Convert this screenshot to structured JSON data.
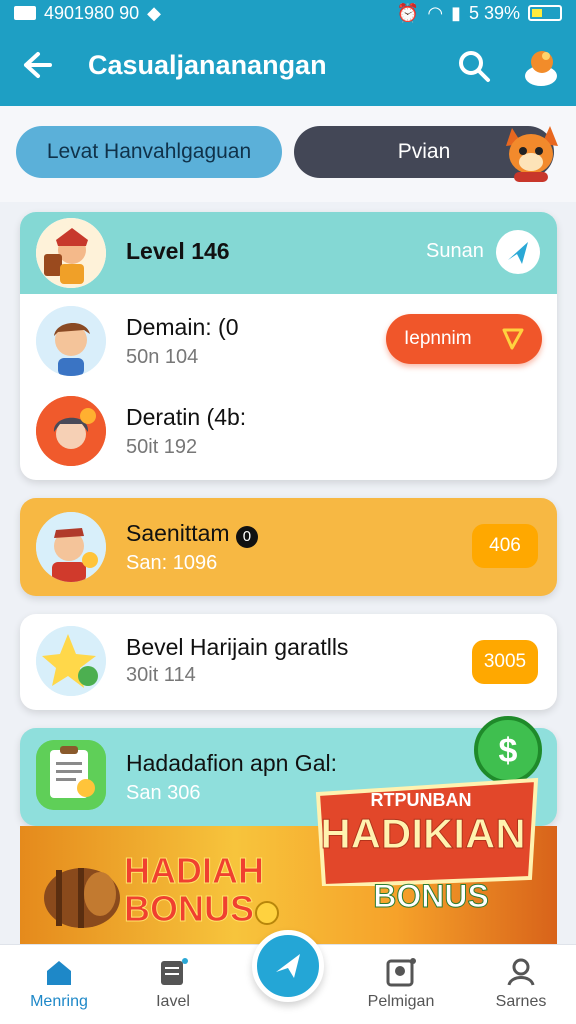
{
  "status_bar": {
    "left_text": "4901980 90",
    "battery_text": "5 39%"
  },
  "app_bar": {
    "title": "Casualjananangan"
  },
  "tabs": {
    "level_label": "Levat Hanvahlgaguan",
    "other_label": "Pvian"
  },
  "cards": [
    {
      "header_title": "Level 146",
      "header_right": "Sunan",
      "rows": [
        {
          "title": "Demain: (0",
          "subtitle": "50n 104",
          "action": "Iepnnim"
        },
        {
          "title": "Deratin (4b:",
          "subtitle": "50it 192"
        }
      ]
    },
    {
      "title": "Saenittam",
      "title_badge": "0",
      "subtitle": "San: 1096",
      "badge": "406"
    },
    {
      "title": "Bevel Harijain garatlls",
      "subtitle": "30it 114",
      "badge": "3005"
    },
    {
      "title": "Hadadafion apn Gal:",
      "subtitle": "San 306"
    }
  ],
  "banner": {
    "left_line1": "HADIAH",
    "left_line2": "BONUS",
    "board_small": "RTPUNBAN",
    "board_big": "HADIKIAN",
    "board_bonus": "BONUS"
  },
  "nav": {
    "items": [
      "Menring",
      "Iavel",
      "Pelmigan",
      "Sarnes"
    ]
  },
  "colors": {
    "primary": "#1e9fc4",
    "accent_orange": "#f0562a",
    "accent_yellow": "#f7b843",
    "teal_card": "#84d8d4"
  }
}
